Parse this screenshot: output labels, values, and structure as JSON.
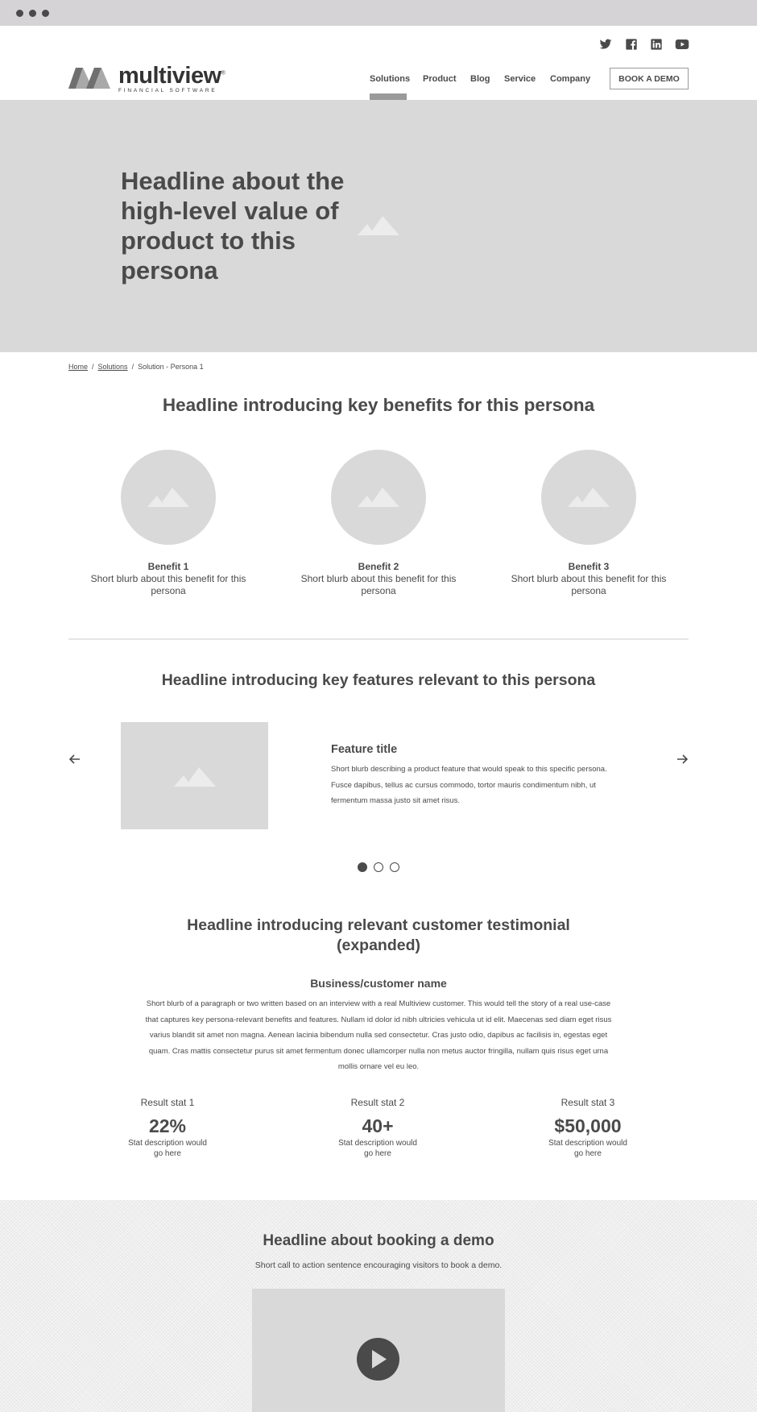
{
  "browser": {
    "dots": [
      "window-dot",
      "window-dot",
      "window-dot"
    ]
  },
  "social": [
    {
      "name": "twitter-icon"
    },
    {
      "name": "facebook-icon"
    },
    {
      "name": "linkedin-icon"
    },
    {
      "name": "youtube-icon"
    }
  ],
  "logo": {
    "wordmark": "multiview",
    "registered": "®",
    "tagline": "FINANCIAL SOFTWARE"
  },
  "nav": {
    "items": [
      {
        "label": "Solutions",
        "active": true
      },
      {
        "label": "Product"
      },
      {
        "label": "Blog"
      },
      {
        "label": "Service"
      },
      {
        "label": "Company"
      }
    ],
    "cta_label": "BOOK A DEMO"
  },
  "hero": {
    "title": "Headline about the high-level value of product to this persona"
  },
  "breadcrumb": {
    "home": "Home",
    "solutions": "Solutions",
    "current": "Solution - Persona 1",
    "separator": "/"
  },
  "benefits": {
    "title": "Headline introducing key benefits for this persona",
    "items": [
      {
        "title": "Benefit 1",
        "text": "Short blurb about this benefit for this persona"
      },
      {
        "title": "Benefit 2",
        "text": "Short blurb about this benefit for this persona"
      },
      {
        "title": "Benefit 3",
        "text": "Short blurb about this benefit for this persona"
      }
    ]
  },
  "features": {
    "title": "Headline introducing key features relevant to this persona",
    "feature_title": "Feature title",
    "feature_text": "Short blurb describing a product feature that would speak to this specific persona. Fusce dapibus, tellus ac cursus commodo, tortor mauris condimentum nibh, ut fermentum massa justo sit amet risus.",
    "slides": 3,
    "active_slide": 1
  },
  "testimonial": {
    "title": "Headline introducing relevant customer testimonial (expanded)",
    "customer": "Business/customer name",
    "text": "Short blurb of a paragraph or two written based on an interview with a real Multiview customer. This would tell the story of a real use-case that captures key persona-relevant benefits and features. Nullam id dolor id nibh ultricies vehicula ut id elit. Maecenas sed diam eget risus varius blandit sit amet non magna. Aenean lacinia bibendum nulla sed consectetur. Cras justo odio, dapibus ac facilisis in, egestas eget quam. Cras mattis consectetur purus sit amet fermentum donec ullamcorper nulla non metus auctor fringilla, nullam quis risus eget urna mollis ornare vel eu leo.",
    "stats": [
      {
        "label": "Result stat 1",
        "value": "22%",
        "desc": "Stat description would go here"
      },
      {
        "label": "Result stat 2",
        "value": "40+",
        "desc": "Stat description would go here"
      },
      {
        "label": "Result stat 3",
        "value": "$50,000",
        "desc": "Stat description would go here"
      }
    ]
  },
  "cta": {
    "title": "Headline about booking a demo",
    "subtitle": "Short call to action sentence encouraging visitors to book a demo."
  },
  "colors": {
    "text": "#4a4a4a",
    "placeholder": "#d9d9d9",
    "chrome": "#d5d3d5",
    "active_bar": "#9a9a9a"
  }
}
